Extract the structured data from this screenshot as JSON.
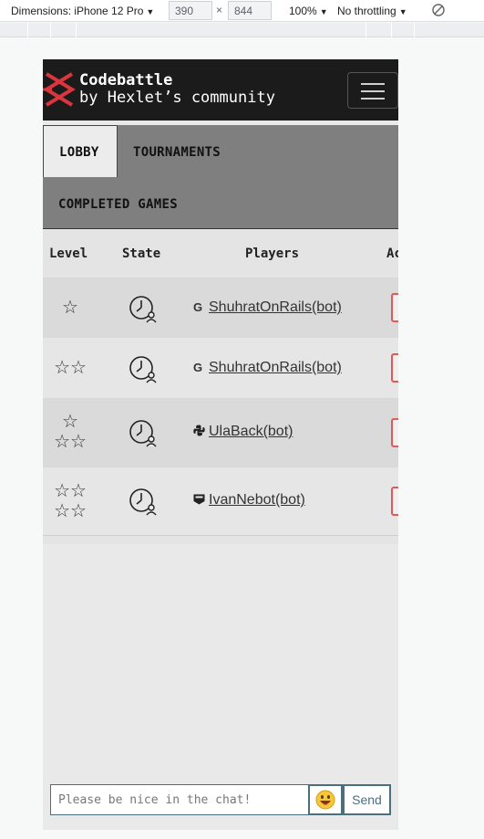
{
  "devtools": {
    "dimensions_label": "Dimensions: iPhone 12 Pro",
    "width": "390",
    "times": "×",
    "height": "844",
    "zoom": "100%",
    "throttling": "No throttling"
  },
  "navbar": {
    "brand_title": "Codebattle",
    "brand_subtitle": "by Hexlet’s community"
  },
  "tabs": [
    {
      "label": "LOBBY",
      "active": true
    },
    {
      "label": "TOURNAMENTS",
      "active": false
    },
    {
      "label": "COMPLETED GAMES",
      "active": false
    }
  ],
  "table": {
    "headers": {
      "level": "Level",
      "state": "State",
      "players": "Players",
      "actions": "Actions"
    },
    "rows": [
      {
        "level_stars_top": "☆",
        "level_stars_bottom": "",
        "state": "waiting-clock-icon",
        "lang_icon": "C++",
        "player": "ShuhratOnRails(bot)"
      },
      {
        "level_stars_top": "☆☆",
        "level_stars_bottom": "",
        "state": "waiting-clock-icon",
        "lang_icon": "C++",
        "player": "ShuhratOnRails(bot)"
      },
      {
        "level_stars_top": "☆",
        "level_stars_bottom": "☆☆",
        "state": "waiting-clock-icon",
        "lang_icon": "python",
        "player": "UlaBack(bot)"
      },
      {
        "level_stars_top": "☆☆",
        "level_stars_bottom": "☆☆",
        "state": "waiting-clock-icon",
        "lang_icon": "php",
        "player": "IvanNebot(bot)"
      }
    ]
  },
  "chat": {
    "placeholder": "Please be nice in the chat!",
    "emoji": "😀",
    "send_label": "Send"
  },
  "colors": {
    "navbar_bg": "#1b1b1b",
    "logo_red": "#d9363e",
    "tabs_bg": "#7f7f7f",
    "action_red": "#e05a5a",
    "chat_border": "#4b6f7e"
  }
}
